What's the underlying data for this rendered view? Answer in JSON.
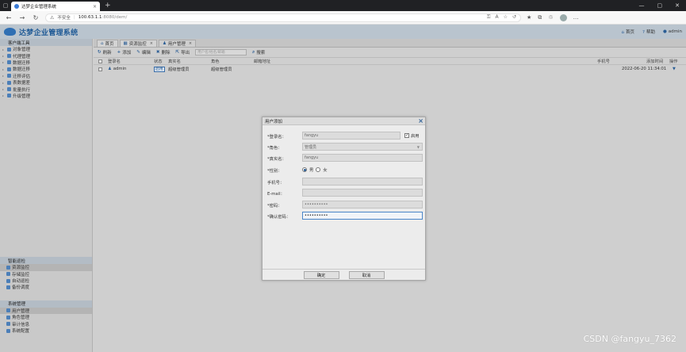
{
  "browser": {
    "tab_title": "达梦企业管理系统",
    "url_security": "不安全",
    "url_host": "100.63.1.1",
    "url_path": ":8080/dem/"
  },
  "app": {
    "title": "达梦企业管理系统",
    "links": {
      "home": "首页",
      "help": "帮助",
      "user": "admin"
    }
  },
  "sidebar": {
    "panel1": "客户端工具",
    "tools": [
      "对象管理",
      "代理管理",
      "数据迁移",
      "数据迁移",
      "迁移评估",
      "表数据差",
      "批量执行",
      "升级管理"
    ],
    "panel2": "智能巡检",
    "inspect": [
      "资源监控",
      "存储监控",
      "自动巡检",
      "备份调度"
    ],
    "panel3": "系统管理",
    "system": [
      "用户管理",
      "角色管理",
      "审计信息",
      "系统配置"
    ]
  },
  "tabs": [
    "首页",
    "资源监控",
    "用户管理"
  ],
  "toolbar": {
    "refresh": "刷新",
    "add": "添加",
    "edit": "编辑",
    "delete": "删除",
    "export": "导出",
    "search_placeholder": "用户名/姓名/邮箱",
    "search": "搜索"
  },
  "grid": {
    "columns": [
      "登录名",
      "状态",
      "真实名",
      "角色",
      "邮箱地址",
      "手机号",
      "添加时间",
      "操作"
    ],
    "row": {
      "login": "admin",
      "status": "启用",
      "real_name": "超级管理员",
      "role": "超级管理员",
      "email": "",
      "phone": "",
      "added": "2022-06-20 11:34:01"
    }
  },
  "modal": {
    "title": "用户添加",
    "fields": {
      "login_label": "*登录名：",
      "login_value": "fangyu",
      "enable_label": "启用",
      "role_label": "*角色：",
      "role_value": "管理员",
      "realname_label": "*真实名：",
      "realname_value": "fangyu",
      "gender_label": "*性别：",
      "male": "男",
      "female": "女",
      "phone_label": "手机号：",
      "email_label": "E-mail：",
      "password_label": "*密码：",
      "password_value": "••••••••••",
      "confirm_label": "*确认密码：",
      "confirm_value": "••••••••••"
    },
    "ok": "确定",
    "cancel": "取消"
  },
  "watermark": "CSDN @fangyu_7362"
}
